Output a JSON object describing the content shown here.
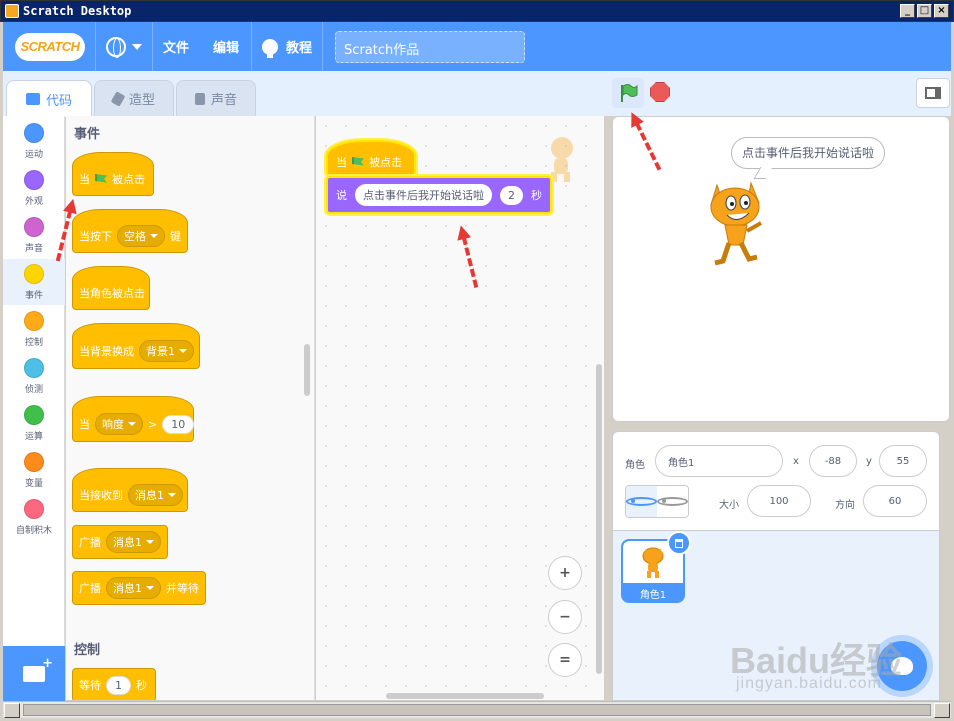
{
  "window": {
    "title": "Scratch Desktop",
    "minimize": "_",
    "maximize": "□",
    "close": "×"
  },
  "menubar": {
    "logo": "SCRATCH",
    "file": "文件",
    "edit": "编辑",
    "tutorials": "教程",
    "project_title": "Scratch作品"
  },
  "tabs": {
    "code": "代码",
    "costumes": "造型",
    "sounds": "声音"
  },
  "categories": [
    {
      "label": "运动",
      "color": "#4c97ff"
    },
    {
      "label": "外观",
      "color": "#9966ff"
    },
    {
      "label": "声音",
      "color": "#cf63cf"
    },
    {
      "label": "事件",
      "color": "#ffd500"
    },
    {
      "label": "控制",
      "color": "#ffab19"
    },
    {
      "label": "侦测",
      "color": "#4cbfe6"
    },
    {
      "label": "运算",
      "color": "#40bf4a"
    },
    {
      "label": "变量",
      "color": "#ff8c1a"
    },
    {
      "label": "自制积木",
      "color": "#ff6680"
    }
  ],
  "palette": {
    "events_title": "事件",
    "control_title": "控制",
    "when_flag_1": "当",
    "when_flag_2": "被点击",
    "when_key_1": "当按下",
    "when_key_dd": "空格",
    "when_key_2": "键",
    "when_sprite_clicked": "当角色被点击",
    "when_backdrop_1": "当背景换成",
    "when_backdrop_dd": "背景1",
    "when_loudness_1": "当",
    "when_loudness_dd": "响度",
    "when_loudness_op": ">",
    "when_loudness_val": "10",
    "when_receive_1": "当接收到",
    "when_receive_dd": "消息1",
    "broadcast_1": "广播",
    "broadcast_dd": "消息1",
    "broadcast_wait_1": "广播",
    "broadcast_wait_dd": "消息1",
    "broadcast_wait_2": "并等待",
    "wait_1": "等待",
    "wait_val": "1",
    "wait_2": "秒"
  },
  "script": {
    "hat_1": "当",
    "hat_2": "被点击",
    "say_1": "说",
    "say_text": "点击事件后我开始说话啦",
    "say_secs": "2",
    "say_2": "秒"
  },
  "zoom": {
    "in": "+",
    "out": "−",
    "reset": "="
  },
  "stage": {
    "bubble": "点击事件后我开始说话啦"
  },
  "sprite_info": {
    "sprite_label": "角色",
    "sprite_name": "角色1",
    "x_label": "x",
    "x_value": "-88",
    "y_label": "y",
    "y_value": "55",
    "size_label": "大小",
    "size_value": "100",
    "direction_label": "方向",
    "direction_value": "60"
  },
  "sprite_list": {
    "sprite_name": "角色1"
  },
  "watermark": {
    "main": "Baidu经验",
    "sub": "jingyan.baidu.com"
  }
}
